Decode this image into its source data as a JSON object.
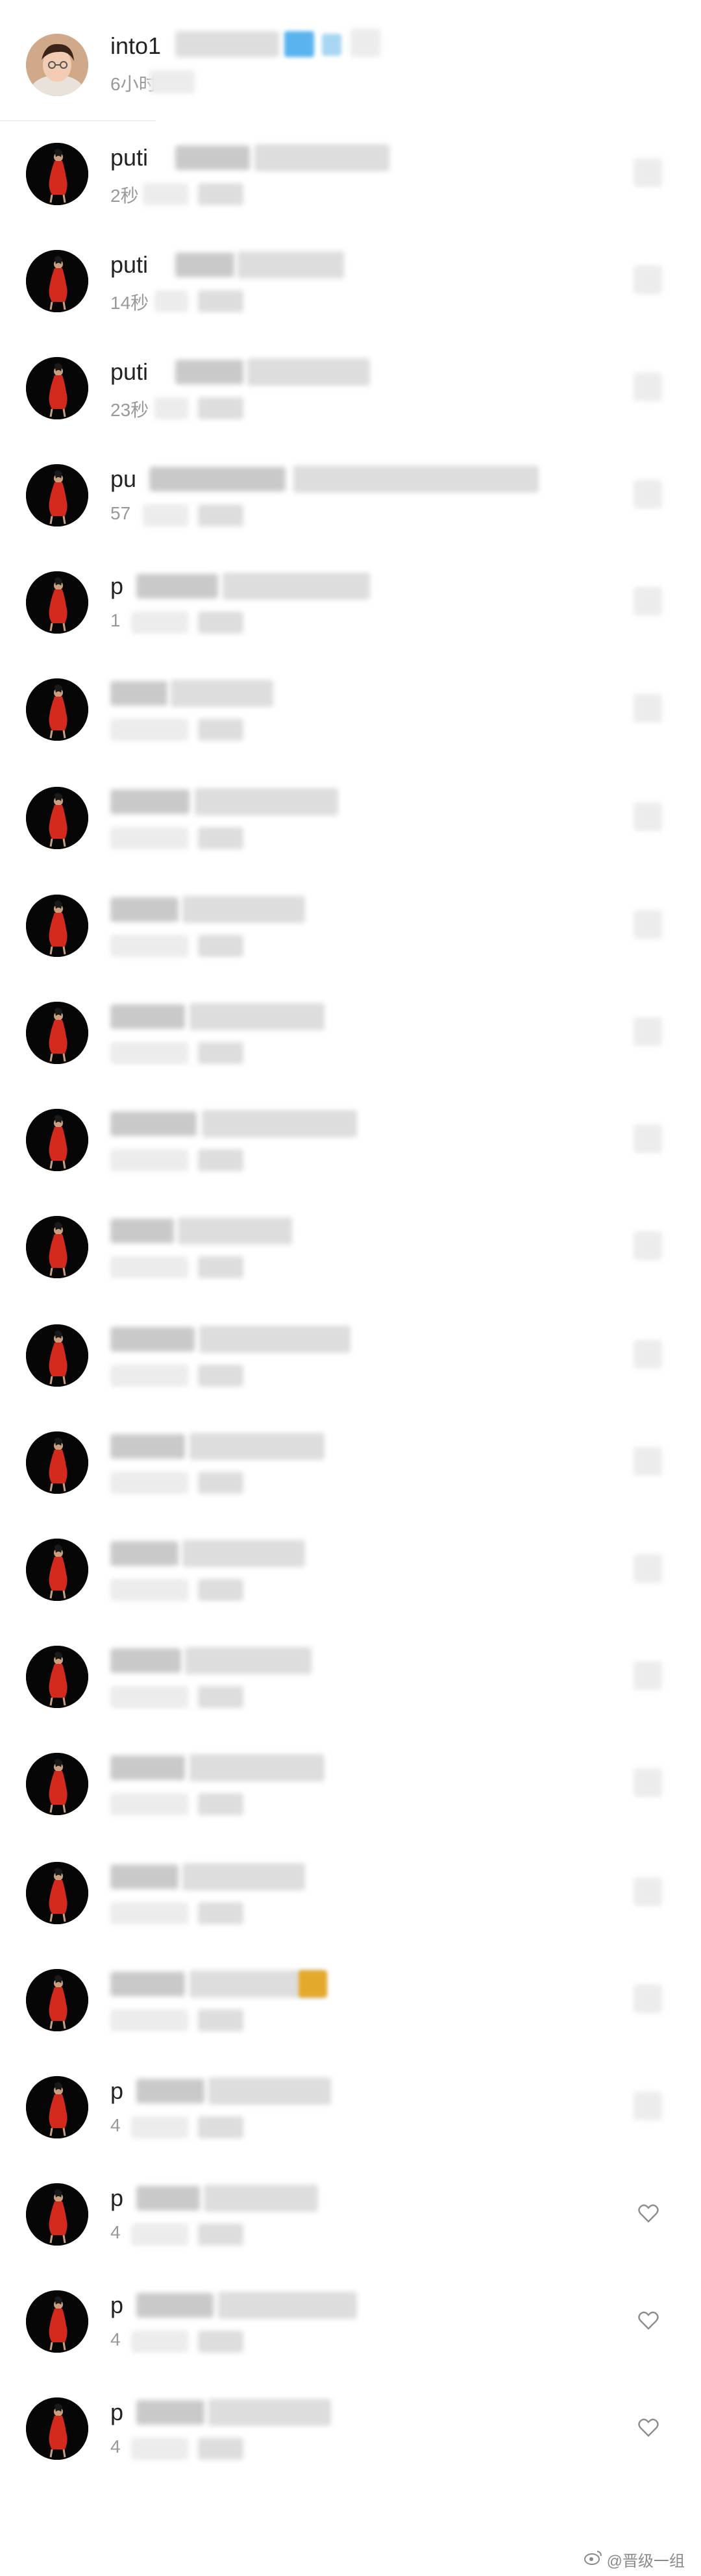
{
  "header": {
    "username": "into1",
    "time": "6小时"
  },
  "comments": [
    {
      "name": "puti",
      "time": "2秒",
      "liked": false,
      "icon": "blurred"
    },
    {
      "name": "puti",
      "time": "14秒",
      "liked": false,
      "icon": "blurred"
    },
    {
      "name": "puti",
      "time": "23秒",
      "liked": false,
      "icon": "blurred"
    },
    {
      "name": "pu",
      "time": "57",
      "liked": false,
      "icon": "blurred"
    },
    {
      "name": "p",
      "time": "1",
      "liked": false,
      "icon": "blurred"
    },
    {
      "name": "",
      "time": "",
      "liked": false,
      "icon": "blurred"
    },
    {
      "name": "",
      "time": "",
      "liked": false,
      "icon": "blurred"
    },
    {
      "name": "",
      "time": "",
      "liked": false,
      "icon": "blurred"
    },
    {
      "name": "",
      "time": "",
      "liked": false,
      "icon": "blurred"
    },
    {
      "name": "",
      "time": "",
      "liked": false,
      "icon": "blurred"
    },
    {
      "name": "",
      "time": "",
      "liked": false,
      "icon": "blurred"
    },
    {
      "name": "",
      "time": "",
      "liked": false,
      "icon": "blurred"
    },
    {
      "name": "",
      "time": "",
      "liked": false,
      "icon": "blurred"
    },
    {
      "name": "",
      "time": "",
      "liked": false,
      "icon": "blurred"
    },
    {
      "name": "",
      "time": "",
      "liked": false,
      "icon": "blurred"
    },
    {
      "name": "",
      "time": "",
      "liked": false,
      "icon": "blurred"
    },
    {
      "name": "",
      "time": "",
      "liked": false,
      "icon": "blurred"
    },
    {
      "name": "",
      "time": "",
      "liked": false,
      "icon": "blurred"
    },
    {
      "name": "p",
      "time": "4",
      "liked": false,
      "icon": "blurred"
    },
    {
      "name": "p",
      "time": "4",
      "liked": false,
      "icon": "heart-icon"
    },
    {
      "name": "p",
      "time": "4",
      "liked": false,
      "icon": "heart-icon"
    },
    {
      "name": "p",
      "time": "4",
      "liked": false,
      "icon": "heart-icon"
    }
  ],
  "watermark": {
    "text": "@晋级一组"
  },
  "colors": {
    "text_primary": "#222222",
    "text_secondary": "#999999",
    "avatar_dress": "#d42a1e",
    "highlight_blue": "#5ab3ee",
    "highlight_yellow": "#e3a92b"
  }
}
